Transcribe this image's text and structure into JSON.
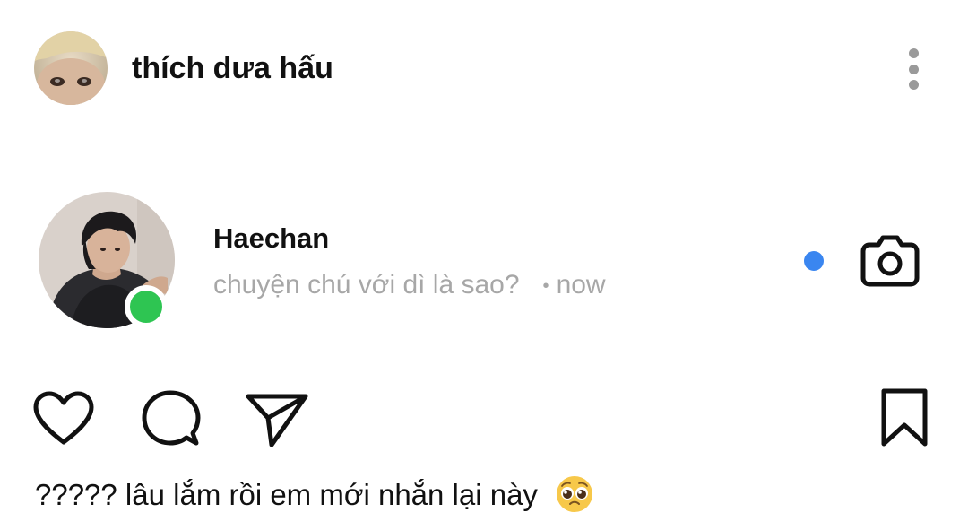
{
  "header": {
    "username": "thích dưa hấu",
    "avatar_icon": "profile-photo",
    "more_icon": "more-vertical-icon"
  },
  "story": {
    "name": "Haechan",
    "preview": "chuyện chú với dì là sao?",
    "separator": "•",
    "time": "now",
    "online": true,
    "unread": true,
    "camera_icon": "camera-icon"
  },
  "actions": {
    "like_icon": "heart-icon",
    "comment_icon": "comment-icon",
    "share_icon": "send-icon",
    "save_icon": "bookmark-icon"
  },
  "caption": {
    "text": "????? lâu lắm rồi em mới nhắn lại này",
    "emoji_icon": "pleading-face-emoji"
  },
  "colors": {
    "online": "#2ec552",
    "unread": "#3a86f0",
    "secondary_text": "#a7a7a7",
    "primary_text": "#111111"
  }
}
